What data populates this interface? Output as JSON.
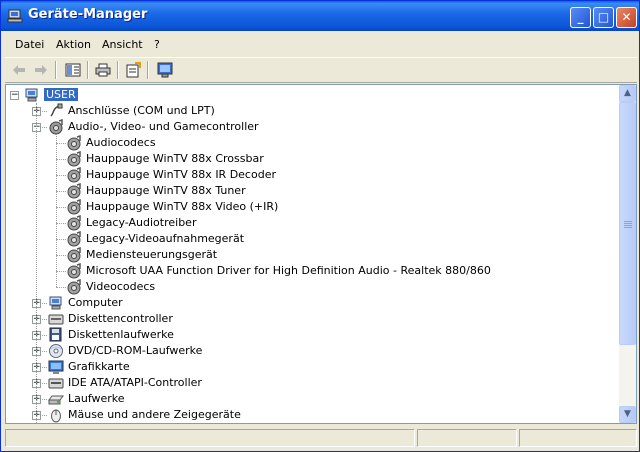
{
  "window": {
    "title": "Geräte-Manager"
  },
  "menu": [
    "Datei",
    "Aktion",
    "Ansicht",
    "?"
  ],
  "toolbar": [
    {
      "icon": "back-arrow-icon"
    },
    {
      "icon": "forward-arrow-icon"
    },
    {
      "icon": "show-hide-console-tree-icon"
    },
    {
      "icon": "print-icon"
    },
    {
      "icon": "properties-icon"
    },
    {
      "icon": "scan-hardware-icon"
    }
  ],
  "tree": {
    "root": "USER",
    "audio_children": [
      "Audiocodecs",
      "Hauppauge WinTV 88x Crossbar",
      "Hauppauge WinTV 88x IR Decoder",
      "Hauppauge WinTV 88x Tuner",
      "Hauppauge WinTV 88x Video (+IR)",
      "Legacy-Audiotreiber",
      "Legacy-Videoaufnahmegerät",
      "Mediensteuerungsgerät",
      "Microsoft UAA Function Driver for High Definition Audio - Realtek 880/860",
      "Videocodecs"
    ],
    "categories": [
      {
        "label": "Anschlüsse (COM und LPT)",
        "icon": "port-icon",
        "expanded": false
      },
      {
        "label": "Audio-, Video- und Gamecontroller",
        "icon": "sound-device-icon",
        "expanded": true
      },
      {
        "label": "Computer",
        "icon": "computer-icon",
        "expanded": false
      },
      {
        "label": "Diskettencontroller",
        "icon": "floppy-controller-icon",
        "expanded": false
      },
      {
        "label": "Diskettenlaufwerke",
        "icon": "floppy-drive-icon",
        "expanded": false
      },
      {
        "label": "DVD/CD-ROM-Laufwerke",
        "icon": "cdrom-icon",
        "expanded": false
      },
      {
        "label": "Grafikkarte",
        "icon": "display-adapter-icon",
        "expanded": false
      },
      {
        "label": "IDE ATA/ATAPI-Controller",
        "icon": "ide-controller-icon",
        "expanded": false
      },
      {
        "label": "Laufwerke",
        "icon": "disk-drive-icon",
        "expanded": false
      },
      {
        "label": "Mäuse und andere Zeigegeräte",
        "icon": "mouse-icon",
        "expanded": false
      }
    ]
  },
  "colors": {
    "titlebar": "#0a53d6",
    "selection": "#316ac5"
  }
}
